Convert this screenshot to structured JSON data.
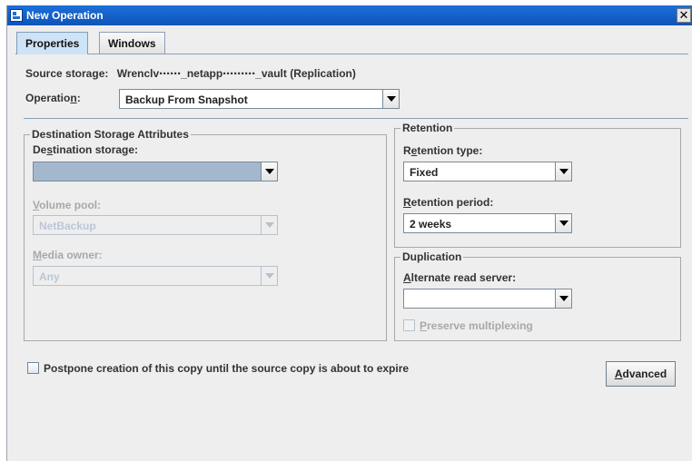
{
  "window": {
    "title": "New Operation",
    "close_glyph": "✕"
  },
  "tabs": [
    {
      "label": "Properties",
      "active": true
    },
    {
      "label": "Windows",
      "active": false
    }
  ],
  "source_storage": {
    "label": "Source storage:",
    "value": "Wrenclv⋯⋯_netapp⋯⋯⋯_vault (Replication)"
  },
  "operation": {
    "label_pre": "Operatio",
    "label_u": "n",
    "label_post": ":",
    "value": "Backup From Snapshot"
  },
  "destination": {
    "title": "Destination Storage Attributes",
    "storage": {
      "label_pre": "De",
      "label_u": "s",
      "label_post": "tination storage:",
      "value": ""
    },
    "volume_pool": {
      "label_u": "V",
      "label_post": "olume pool:",
      "value": "NetBackup",
      "disabled": true
    },
    "media_owner": {
      "label_u": "M",
      "label_post": "edia owner:",
      "value": "Any",
      "disabled": true
    }
  },
  "retention": {
    "title": "Retention",
    "type": {
      "label_pre": "R",
      "label_u": "e",
      "label_post": "tention type:",
      "value": "Fixed"
    },
    "period": {
      "label_u": "R",
      "label_post": "etention period:",
      "value": "2 weeks"
    }
  },
  "duplication": {
    "title": "Duplication",
    "read_server": {
      "label_u": "A",
      "label_post": "lternate read server:",
      "value": ""
    },
    "preserve": {
      "label_u": "P",
      "label_post": "reserve multiplexing",
      "checked": false,
      "disabled": true
    }
  },
  "postpone": {
    "label": "Postpone creation of this copy until the source copy is about to expire",
    "checked": false
  },
  "advanced_button": {
    "label_u": "A",
    "label_post": "dvanced"
  },
  "colors": {
    "titlebar": "#0d54b8",
    "active_tab": "#cfe3f6",
    "selected_field": "#a3b8cc",
    "disabled_text": "#a8a8a8"
  },
  "icons": [
    "app-icon",
    "close-icon",
    "chevron-down-icon",
    "checkbox-icon"
  ]
}
